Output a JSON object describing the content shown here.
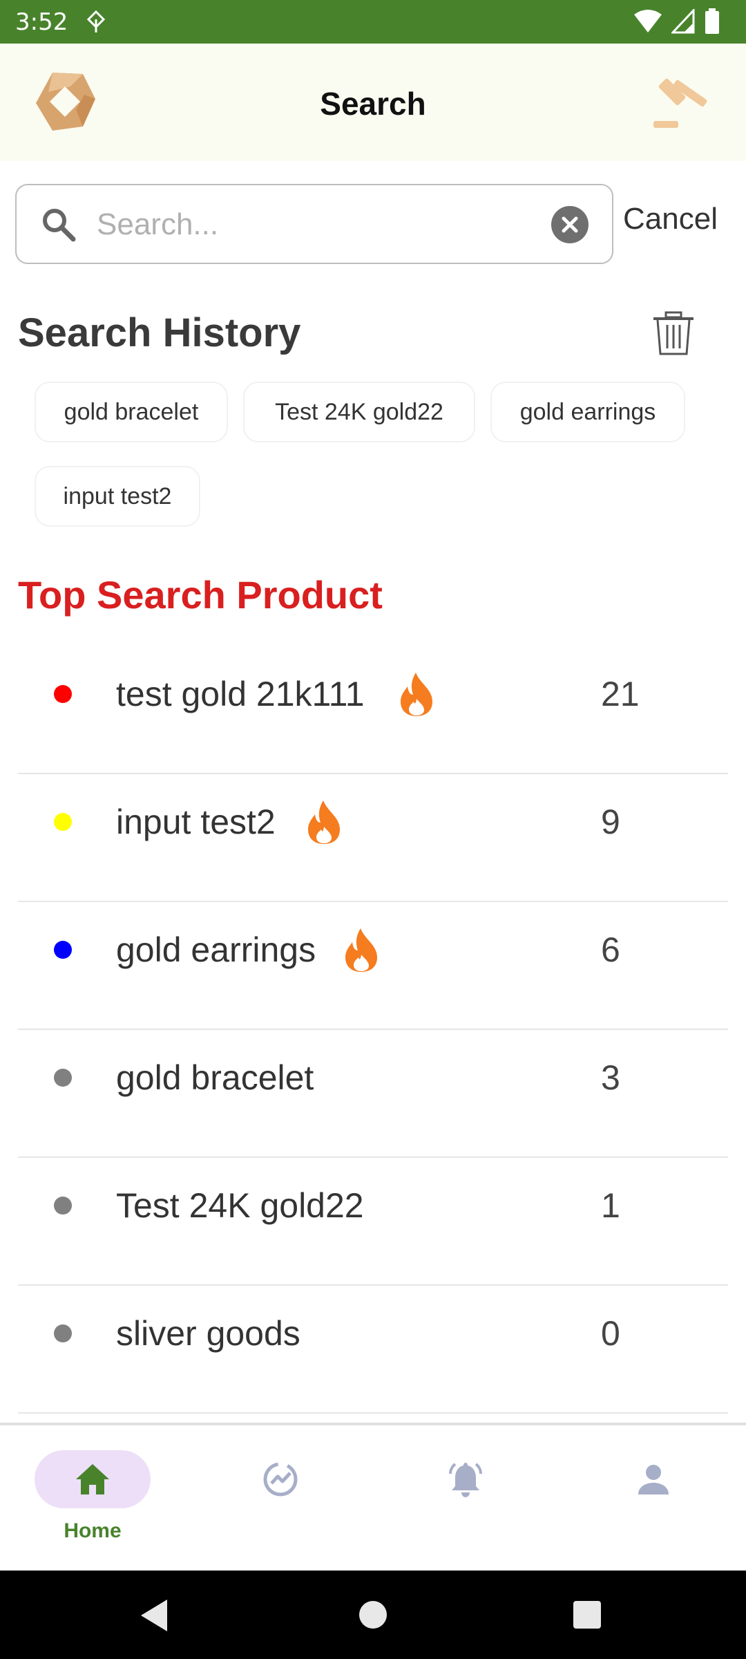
{
  "status_bar": {
    "time": "3:52"
  },
  "header": {
    "title": "Search"
  },
  "search": {
    "placeholder": "Search...",
    "value": "",
    "cancel_label": "Cancel"
  },
  "history": {
    "title": "Search History",
    "chips": [
      "gold bracelet",
      "Test 24K gold22",
      "gold earrings",
      "input test2"
    ]
  },
  "top_search": {
    "title": "Top Search Product",
    "items": [
      {
        "name": "test gold 21k111",
        "count": "21",
        "dot_color": "#ff0000",
        "hot": true
      },
      {
        "name": "input test2",
        "count": "9",
        "dot_color": "#ffff00",
        "hot": true
      },
      {
        "name": "gold earrings",
        "count": "6",
        "dot_color": "#0000ff",
        "hot": true
      },
      {
        "name": "gold bracelet",
        "count": "3",
        "dot_color": "#808080",
        "hot": false
      },
      {
        "name": "Test 24K gold22",
        "count": "1",
        "dot_color": "#808080",
        "hot": false
      },
      {
        "name": "sliver goods",
        "count": "0",
        "dot_color": "#808080",
        "hot": false
      }
    ]
  },
  "bottom_nav": {
    "items": [
      {
        "label": "Home",
        "icon": "home-icon",
        "active": true
      },
      {
        "label": "",
        "icon": "activity-chart-icon",
        "active": false
      },
      {
        "label": "",
        "icon": "bell-icon",
        "active": false
      },
      {
        "label": "",
        "icon": "person-icon",
        "active": false
      }
    ]
  },
  "colors": {
    "brand_green": "#48832c",
    "accent_red": "#d91f1f",
    "fire_orange": "#f57c1f",
    "nav_inactive": "#a7aec8"
  }
}
